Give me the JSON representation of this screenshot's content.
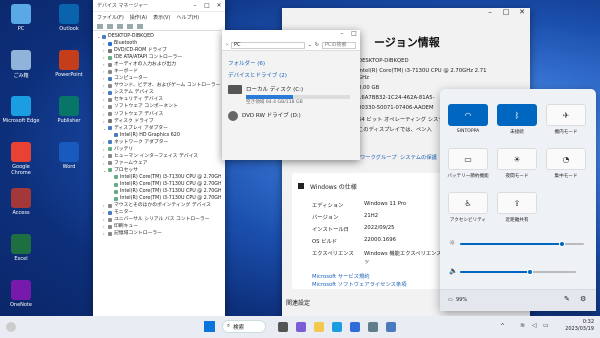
{
  "desktop": {
    "icons": [
      {
        "label": "PC",
        "icon": "pc-icon",
        "color": "#5aa9e6"
      },
      {
        "label": "ごみ箱",
        "icon": "recycle-bin-icon",
        "color": "#8fb3d9"
      },
      {
        "label": "Microsoft Edge",
        "icon": "edge-icon",
        "color": "#1b9de2"
      },
      {
        "label": "Google Chrome",
        "icon": "chrome-icon",
        "color": "#e94235"
      },
      {
        "label": "Access",
        "icon": "access-icon",
        "color": "#a4373a"
      },
      {
        "label": "Excel",
        "icon": "excel-icon",
        "color": "#1d6f42"
      },
      {
        "label": "OneNote",
        "icon": "onenote-icon",
        "color": "#7719aa"
      },
      {
        "label": "Outlook",
        "icon": "outlook-icon",
        "color": "#0a64ad"
      },
      {
        "label": "PowerPoint",
        "icon": "powerpoint-icon",
        "color": "#c43e1c"
      },
      {
        "label": "Publisher",
        "icon": "publisher-icon",
        "color": "#077568"
      },
      {
        "label": "Word",
        "icon": "word-icon",
        "color": "#185abd"
      }
    ]
  },
  "device_manager": {
    "title": "デバイス マネージャー",
    "menu": [
      "ファイル(F)",
      "操作(A)",
      "表示(V)",
      "ヘルプ(H)"
    ],
    "tree": [
      {
        "label": "DESKTOP-DIBKQED",
        "level": 0,
        "expand": "v",
        "color": "#4a7bbf"
      },
      {
        "label": "Bluetooth",
        "level": 1,
        "expand": ">",
        "color": "#2a6fd0"
      },
      {
        "label": "DVD/CD-ROM ドライブ",
        "level": 1,
        "expand": ">",
        "color": "#777"
      },
      {
        "label": "IDE ATA/ATAPI コントローラー",
        "level": 1,
        "expand": ">",
        "color": "#6a8"
      },
      {
        "label": "オーディオの入力および出力",
        "level": 1,
        "expand": ">",
        "color": "#888"
      },
      {
        "label": "キーボード",
        "level": 1,
        "expand": ">",
        "color": "#888"
      },
      {
        "label": "コンピューター",
        "level": 1,
        "expand": ">",
        "color": "#4a7bbf"
      },
      {
        "label": "サウンド、ビデオ、およびゲーム コントローラー",
        "level": 1,
        "expand": ">",
        "color": "#888"
      },
      {
        "label": "システム デバイス",
        "level": 1,
        "expand": ">",
        "color": "#4a7bbf"
      },
      {
        "label": "セキュリティ デバイス",
        "level": 1,
        "expand": ">",
        "color": "#888"
      },
      {
        "label": "ソフトウェア コンポーネント",
        "level": 1,
        "expand": ">",
        "color": "#888"
      },
      {
        "label": "ソフトウェア デバイス",
        "level": 1,
        "expand": ">",
        "color": "#888"
      },
      {
        "label": "ディスク ドライブ",
        "level": 1,
        "expand": ">",
        "color": "#777"
      },
      {
        "label": "ディスプレイ アダプター",
        "level": 1,
        "expand": "v",
        "color": "#4a7bbf"
      },
      {
        "label": "Intel(R) HD Graphics 620",
        "level": 2,
        "expand": "",
        "color": "#4a7bbf"
      },
      {
        "label": "ネットワーク アダプター",
        "level": 1,
        "expand": ">",
        "color": "#4a7bbf"
      },
      {
        "label": "バッテリ",
        "level": 1,
        "expand": ">",
        "color": "#6a8"
      },
      {
        "label": "ヒューマン インターフェイス デバイス",
        "level": 1,
        "expand": ">",
        "color": "#888"
      },
      {
        "label": "ファームウェア",
        "level": 1,
        "expand": ">",
        "color": "#888"
      },
      {
        "label": "プロセッサ",
        "level": 1,
        "expand": "v",
        "color": "#6a8"
      },
      {
        "label": "Intel(R) Core(TM) i3-7130U CPU @ 2.70GH",
        "level": 2,
        "expand": "",
        "color": "#6a8"
      },
      {
        "label": "Intel(R) Core(TM) i3-7130U CPU @ 2.70GH",
        "level": 2,
        "expand": "",
        "color": "#6a8"
      },
      {
        "label": "Intel(R) Core(TM) i3-7130U CPU @ 2.70GH",
        "level": 2,
        "expand": "",
        "color": "#6a8"
      },
      {
        "label": "Intel(R) Core(TM) i3-7130U CPU @ 2.70GH",
        "level": 2,
        "expand": "",
        "color": "#6a8"
      },
      {
        "label": "マウスとそのほかのポインティング デバイス",
        "level": 1,
        "expand": ">",
        "color": "#888"
      },
      {
        "label": "モニター",
        "level": 1,
        "expand": ">",
        "color": "#4a7bbf"
      },
      {
        "label": "ユニバーサル シリアル バス コントローラー",
        "level": 1,
        "expand": ">",
        "color": "#888"
      },
      {
        "label": "印刷キュー",
        "level": 1,
        "expand": ">",
        "color": "#888"
      },
      {
        "label": "記憶域コントローラー",
        "level": 1,
        "expand": ">",
        "color": "#888"
      }
    ]
  },
  "explorer": {
    "address": "PC",
    "search_placeholder": "PCの検索",
    "folders_section": "フォルダー (6)",
    "drives_section": "デバイスとドライブ (2)",
    "drives": [
      {
        "name": "ローカル ディスク (C:)",
        "space": "空き領域 64.4 GB/118 GB",
        "used_fraction": 0.45
      },
      {
        "name": "DVD RW ドライブ (D:)",
        "space": "",
        "used_fraction": 0
      }
    ]
  },
  "system_info": {
    "title": "ージョン情報",
    "device_name": "DESKTOP-DIBKQED",
    "processor": "Intel(R) Core(TM) i3-7130U CPU @ 2.70GHz   2.71",
    "processor_cont": "GHz",
    "ram": "8.00 GB",
    "device_id": "16A7BB32-1C24-462A-81A5-",
    "product_id": "00330-50071-07406-AAOEM",
    "system_type": "64 ビット オペレーティング システム",
    "pen": "このディスプレイでは、ペン入",
    "related_links": [
      "ワークグループ",
      "システムの保護"
    ],
    "spec_heading": "Windows の仕様",
    "specs": [
      {
        "key": "エディション",
        "value": "Windows 11 Pro"
      },
      {
        "key": "バージョン",
        "value": "21H2"
      },
      {
        "key": "インストール日",
        "value": "2022/09/25"
      },
      {
        "key": "OS ビルド",
        "value": "22000.1696"
      },
      {
        "key": "エクスペリエンス",
        "value": "Windows 機能エクスペリエンス パッ"
      }
    ],
    "ms_links": [
      "Microsoft サービス規約",
      "Microsoft ソフトウェアライセンス条項"
    ],
    "bottom_label": "関連設定"
  },
  "quick_settings": {
    "tiles": [
      {
        "label": "SINTOPPA",
        "icon": "wifi-icon",
        "on": true
      },
      {
        "label": "未接続",
        "icon": "bluetooth-icon",
        "on": true
      },
      {
        "label": "機内モード",
        "icon": "airplane-icon",
        "on": false
      },
      {
        "label": "バッテリー節約機能",
        "icon": "battery-saver-icon",
        "on": false
      },
      {
        "label": "夜間モード",
        "icon": "night-light-icon",
        "on": false
      },
      {
        "label": "集中モード",
        "icon": "focus-icon",
        "on": false
      },
      {
        "label": "アクセシビリティ",
        "icon": "accessibility-icon",
        "on": false
      },
      {
        "label": "近距離共有",
        "icon": "nearby-share-icon",
        "on": false
      }
    ],
    "brightness": 0.82,
    "volume": 0.6,
    "battery": "99%"
  },
  "taskbar": {
    "search": "検索",
    "time": "0:32",
    "date": "2023/03/19"
  }
}
